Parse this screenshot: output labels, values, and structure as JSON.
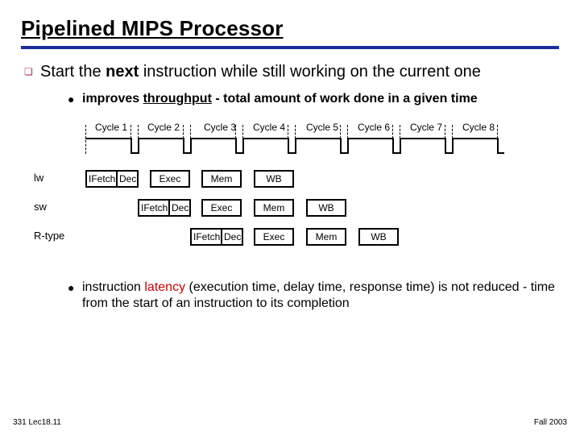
{
  "title": "Pipelined MIPS Processor",
  "bullets": {
    "l1": {
      "t1": "Start the ",
      "t2": "next",
      "t3": " instruction while still working on the current one"
    },
    "l2a": {
      "t1": "improves ",
      "t2": "throughput",
      "t3": " - total amount of work done in a given time"
    },
    "l2b": {
      "t1": "instruction ",
      "t2": "latency",
      "t3": " (execution time, delay time, response time) is not reduced - time from the start of an instruction to its completion"
    }
  },
  "cycles": [
    "Cycle 1",
    "Cycle 2",
    "Cycle 3",
    "Cycle 4",
    "Cycle 5",
    "Cycle 6",
    "Cycle 7",
    "Cycle 8"
  ],
  "stages": {
    "ifetch": "IFetch",
    "dec": "Dec",
    "exec": "Exec",
    "mem": "Mem",
    "wb": "WB"
  },
  "instructions": [
    "lw",
    "sw",
    "R-type"
  ],
  "footer": {
    "left": "331 Lec18.11",
    "right": "Fall 2003"
  },
  "chart_data": {
    "type": "table",
    "title": "Pipelined MIPS Processor stage timing",
    "columns": [
      "Cycle 1",
      "Cycle 2",
      "Cycle 3",
      "Cycle 4",
      "Cycle 5",
      "Cycle 6",
      "Cycle 7",
      "Cycle 8"
    ],
    "rows": [
      {
        "name": "lw",
        "values": [
          "IFetch",
          "Dec",
          "Exec",
          "Mem",
          "WB",
          "",
          "",
          ""
        ]
      },
      {
        "name": "sw",
        "values": [
          "",
          "IFetch",
          "Dec",
          "Exec",
          "Mem",
          "WB",
          "",
          ""
        ]
      },
      {
        "name": "R-type",
        "values": [
          "",
          "",
          "IFetch",
          "Dec",
          "Exec",
          "Mem",
          "WB",
          ""
        ]
      }
    ]
  }
}
